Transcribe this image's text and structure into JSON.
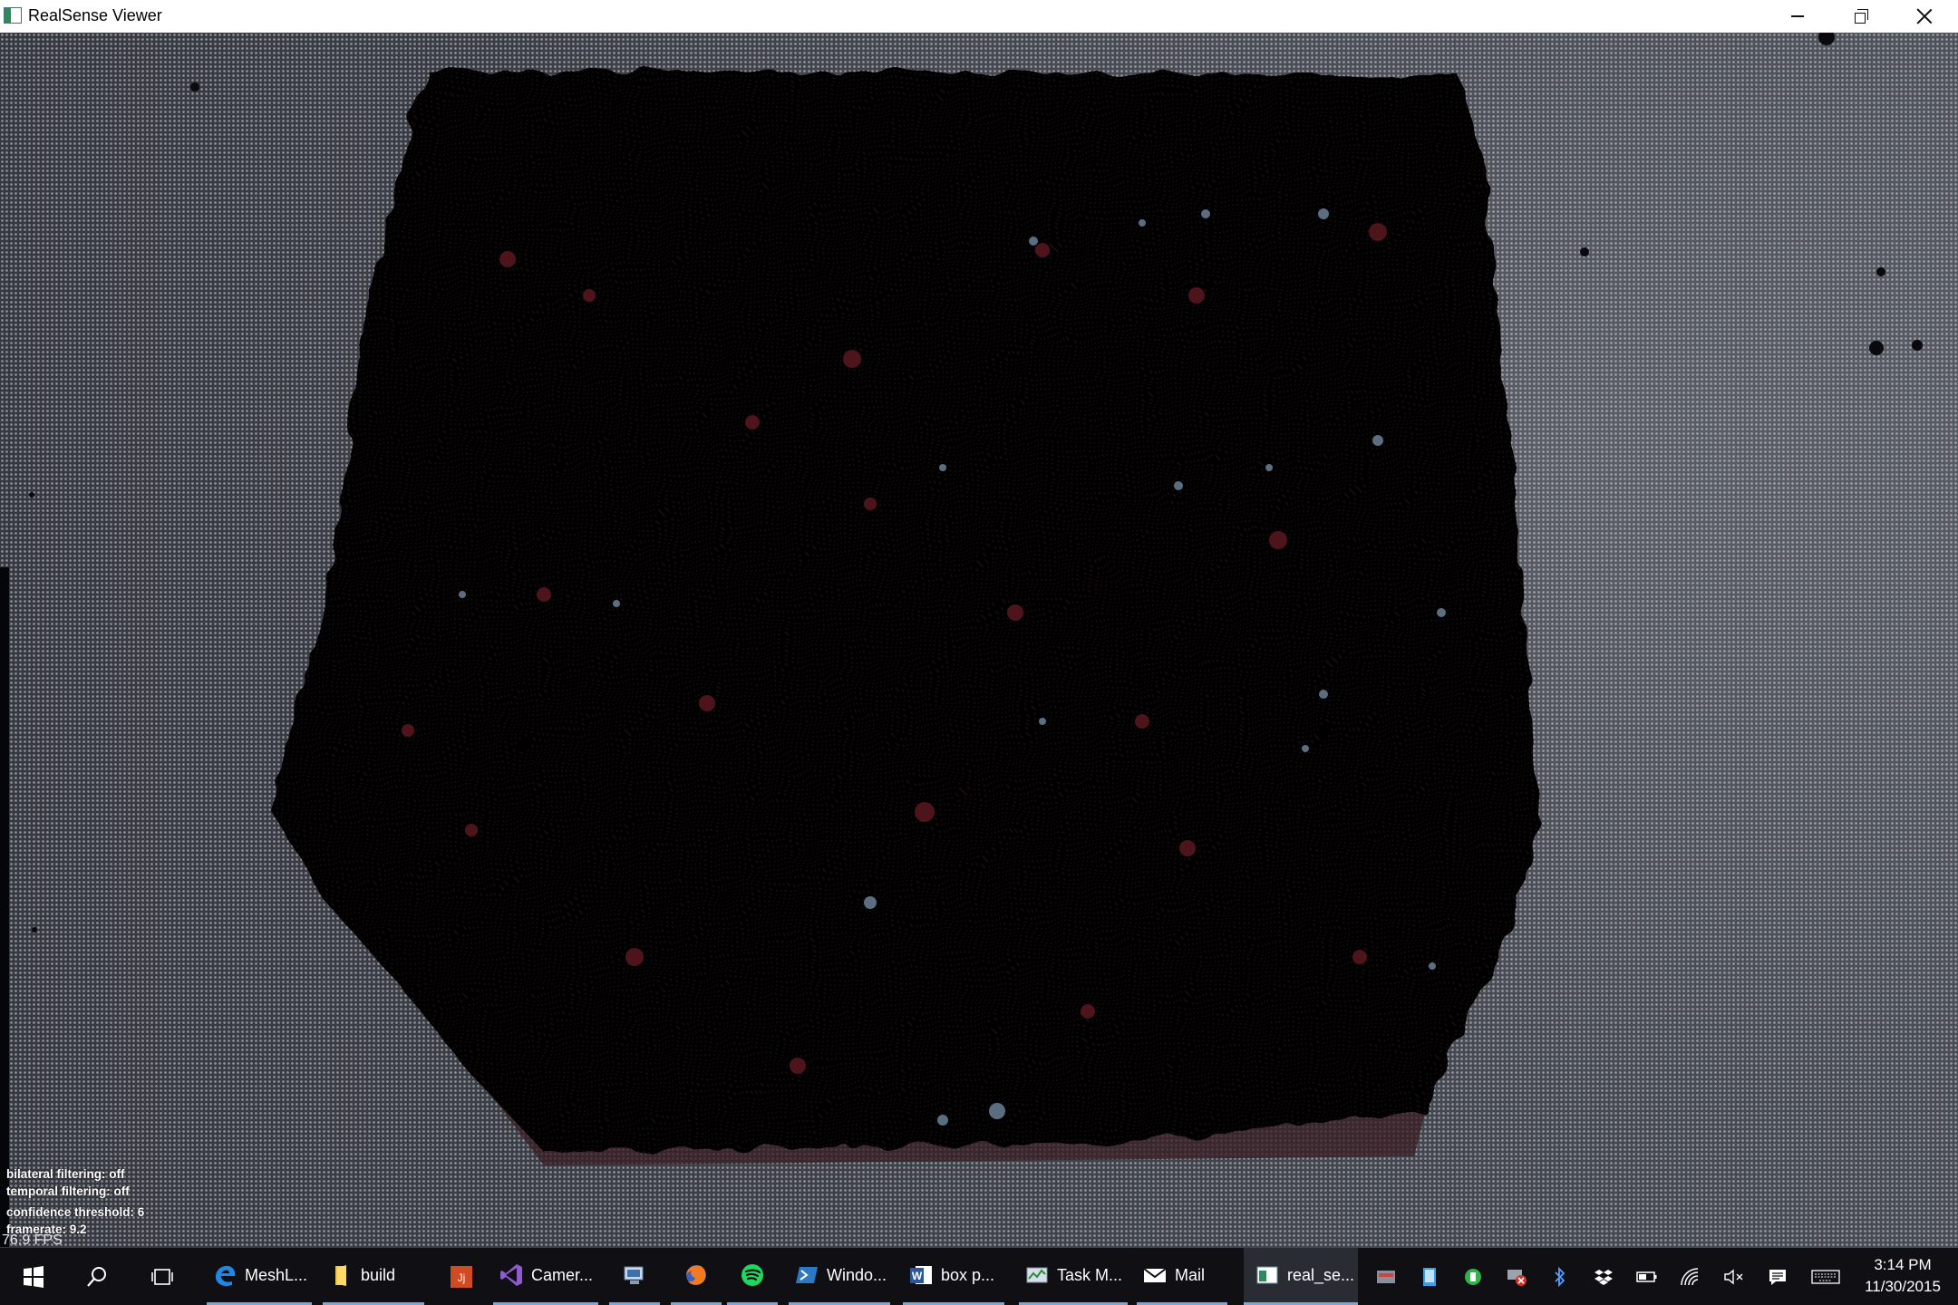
{
  "window": {
    "title": "RealSense Viewer",
    "controls": [
      "minimize",
      "restore",
      "close"
    ]
  },
  "viewer": {
    "overlay_lines": [
      "bilateral filtering: off",
      "temporal filtering: off",
      "confidence threshold: 6",
      "framerate: 9.2"
    ],
    "fps": "76.9 FPS"
  },
  "taskbar": {
    "items": [
      {
        "label": "",
        "icon": "windows-start-icon"
      },
      {
        "label": "",
        "icon": "search-icon"
      },
      {
        "label": "",
        "icon": "task-view-icon"
      },
      {
        "label": "MeshL...",
        "icon": "edge-browser-icon"
      },
      {
        "label": "build",
        "icon": "folder-icon"
      },
      {
        "label": "",
        "icon": "office-app-icon"
      },
      {
        "label": "Camer...",
        "icon": "visual-studio-icon"
      },
      {
        "label": "",
        "icon": "remote-desktop-icon"
      },
      {
        "label": "",
        "icon": "firefox-icon"
      },
      {
        "label": "",
        "icon": "spotify-icon"
      },
      {
        "label": "Windo...",
        "icon": "powershell-icon"
      },
      {
        "label": "box p...",
        "icon": "word-icon"
      },
      {
        "label": "Task M...",
        "icon": "task-manager-icon"
      },
      {
        "label": "Mail",
        "icon": "mail-icon"
      },
      {
        "label": "real_se...",
        "icon": "realsense-app-icon"
      }
    ],
    "tray_icons": [
      "generic-tray-icon",
      "tablet-icon",
      "green-status-icon",
      "network-error-icon",
      "bluetooth-icon",
      "dropbox-icon",
      "battery-icon",
      "wifi-icon",
      "volume-muted-icon",
      "action-center-icon",
      "keyboard-icon"
    ],
    "clock": {
      "time": "3:14 PM",
      "date": "11/30/2015"
    }
  },
  "colors": {
    "titlebar_bg": "#ffffff",
    "taskbar_bg": "#101014",
    "running_indicator": "#7aa7d6",
    "depth_object": "#050305"
  }
}
